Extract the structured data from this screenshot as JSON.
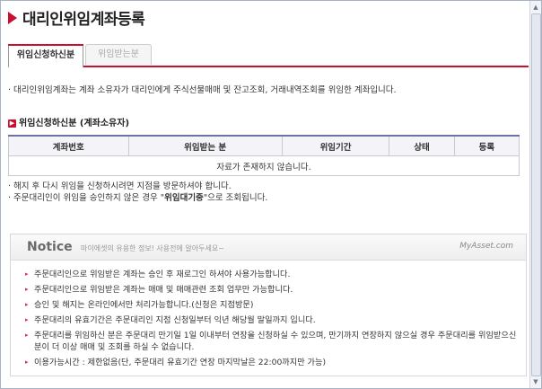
{
  "page": {
    "title": "대리인위임계좌등록"
  },
  "tabs": [
    {
      "label": "위임신청하신분",
      "active": true
    },
    {
      "label": "위임받는분",
      "active": false
    }
  ],
  "description": "· 대리인위임계좌는 계좌 소유자가 대리인에게 주식선물매매 및 잔고조회, 거래내역조회를 위임한 계좌입니다.",
  "section": {
    "title": "위임신청하신분 (계좌소유자)"
  },
  "table": {
    "headers": [
      "계좌번호",
      "위임받는 분",
      "위임기간",
      "상태",
      "등록"
    ],
    "empty_message": "자료가 존재하지 않습니다."
  },
  "notes": {
    "line1": "· 해지 후 다시 위임을 신청하시려면 지점을 방문하셔야 합니다.",
    "line2_prefix": "· 주문대리인이 위임을 승인하지 않은 경우 \"",
    "line2_bold": "위임대기중",
    "line2_suffix": "\"으로 조회됩니다."
  },
  "notice": {
    "title": "Notice",
    "subtitle": "마이에셋의 유용한 정보! 사용전에 알아두세요~",
    "logo": "MyAsset.com",
    "items": [
      "주문대리인으로 위임받은 계좌는 승인 후 재로그인 하셔야 사용가능합니다.",
      "주문대리인으로 위임받은 계좌는 매매 및 매매관련 조회 업무만 가능합니다.",
      "승인 및 해지는 온라인에서만 처리가능합니다.(신청은 지점방문)",
      "주문대리의 유효기간은 주문대리인 지점 신청일부터 익년 해당월 말일까지 입니다.",
      "주문대리를 위임하신 분은 주문대리 만기일 1일 이내부터 연장을 신청하실 수 있으며, 만기까지 연장하지 않으실 경우 주문대리를 위임받으신 분이 더 이상 매매 및 조회를 하실 수 없습니다.",
      "이용가능시간 : 제한없음(단, 주문대리 유효기간 연장 마지막날은 22:00까지만 가능)"
    ]
  },
  "colors": {
    "accent": "#c8102e",
    "table_header_border": "#6a75a5"
  }
}
